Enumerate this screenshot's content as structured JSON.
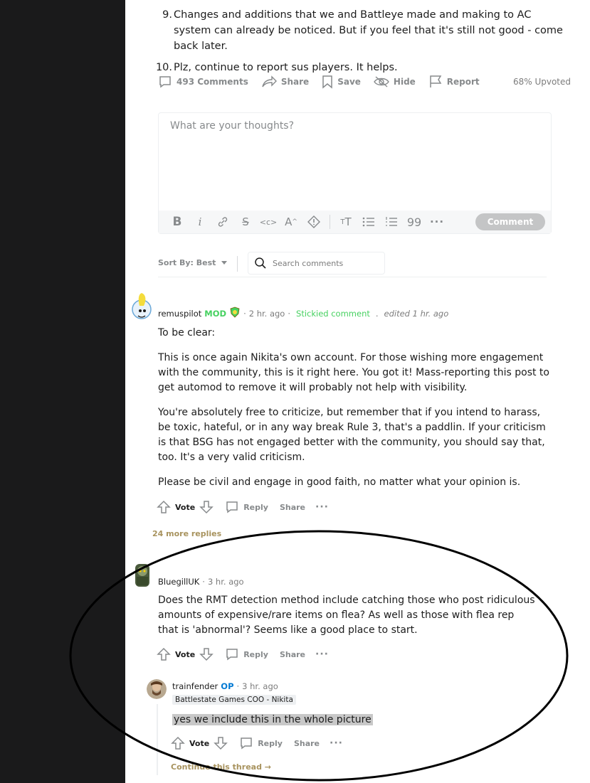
{
  "post": {
    "rules": [
      {
        "num": "9.",
        "text": "Changes and additions that we and Battleye made and making to AC system can already be noticed. But if you feel that it's still not good - come back later."
      },
      {
        "num": "10.",
        "text": "Plz, continue to report sus players. It helps."
      }
    ],
    "actions": {
      "comments": "493 Comments",
      "share": "Share",
      "save": "Save",
      "hide": "Hide",
      "report": "Report",
      "upvoted": "68% Upvoted"
    }
  },
  "editor": {
    "placeholder": "What are your thoughts?",
    "comment_button": "Comment",
    "toolbar_icons": [
      "bold-icon",
      "italic-icon",
      "link-icon",
      "strikethrough-icon",
      "inline-code-icon",
      "superscript-icon",
      "spoiler-icon",
      "heading-icon",
      "bulleted-list-icon",
      "numbered-list-icon",
      "quote-block-icon",
      "more-icon"
    ]
  },
  "sort": {
    "label": "Sort By: Best",
    "search_placeholder": "Search comments"
  },
  "comments": [
    {
      "user": "remuspilot",
      "badge": "MOD",
      "time": "2 hr. ago",
      "sticky": "Stickied comment",
      "edited": "edited 1 hr. ago",
      "paragraphs": [
        "To be clear:",
        "This is once again Nikita's own account. For those wishing more engagement with the community, this is it right here. You got it! Mass-reporting this post to get automod to remove it will probably not help with visibility.",
        "You're absolutely free to criticize, but remember that if you intend to harass, be toxic, hateful, or in any way break Rule 3, that's a paddlin. If your criticism is that BSG has not engaged better with the community, you should say that, too. It's a very valid criticism.",
        "Please be civil and engage in good faith, no matter what your opinion is."
      ],
      "vote": "Vote",
      "reply": "Reply",
      "share": "Share",
      "more_replies": "24 more replies"
    },
    {
      "user": "BluegillUK",
      "time": "3 hr. ago",
      "paragraphs": [
        "Does the RMT detection method include catching those who post ridiculous amounts of expensive/rare items on flea? As well as those with flea rep that is 'abnormal'? Seems like a good place to start."
      ],
      "vote": "Vote",
      "reply": "Reply",
      "share": "Share"
    },
    {
      "user": "trainfender",
      "badge": "OP",
      "time": "3 hr. ago",
      "flair": "Battlestate Games COO - Nikita",
      "text": "yes we include this in the whole picture",
      "vote": "Vote",
      "reply": "Reply",
      "share": "Share",
      "continue": "Continue this thread →"
    }
  ],
  "colors": {
    "sidebar": "#1a1a1b",
    "mod_green": "#46d160",
    "op_blue": "#0079d3",
    "gold_link": "#a8935e",
    "muted": "#878a8c"
  }
}
